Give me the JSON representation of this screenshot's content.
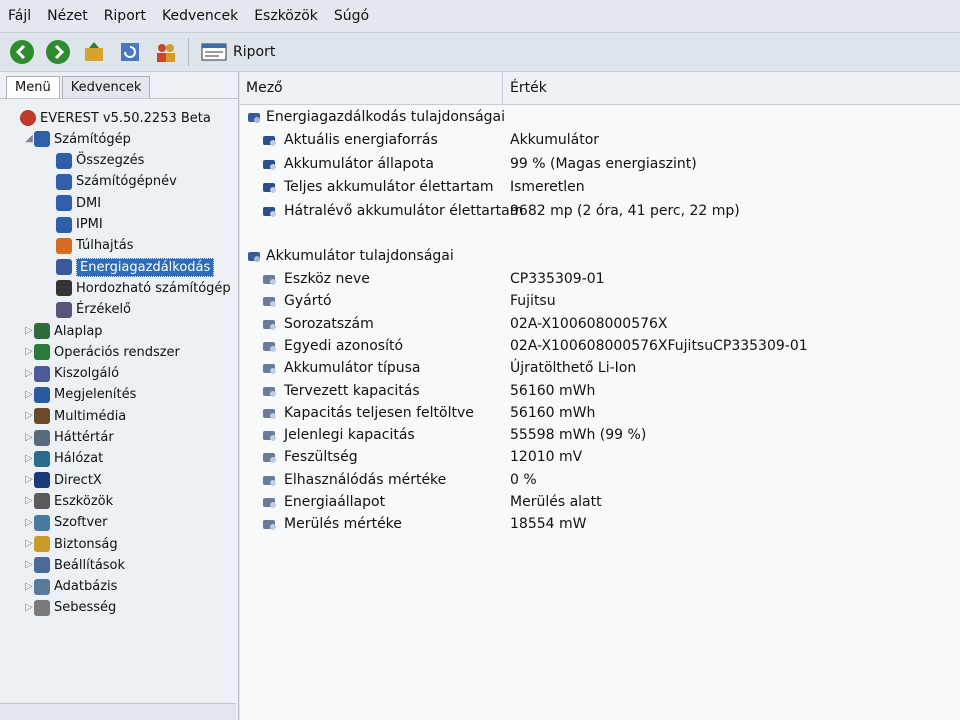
{
  "menubar": {
    "items": [
      "Fájl",
      "Nézet",
      "Riport",
      "Kedvencek",
      "Eszközök",
      "Súgó"
    ]
  },
  "toolbar": {
    "report_label": "Riport"
  },
  "left_panel": {
    "tabs": [
      "Menü",
      "Kedvencek"
    ],
    "tree": [
      {
        "label": "EVEREST v5.50.2253 Beta",
        "icon": "info-icon"
      },
      {
        "label": "Számítógép",
        "icon": "computer-icon"
      },
      {
        "label": "Összegzés",
        "icon": "computer-icon"
      },
      {
        "label": "Számítógépnév",
        "icon": "computer-icon"
      },
      {
        "label": "DMI",
        "icon": "computer-icon"
      },
      {
        "label": "IPMI",
        "icon": "computer-icon"
      },
      {
        "label": "Túlhajtás",
        "icon": "flame-icon"
      },
      {
        "label": "Energiagazdálkodás",
        "icon": "power-icon",
        "selected": true
      },
      {
        "label": "Hordozható számítógép",
        "icon": "laptop-icon"
      },
      {
        "label": "Érzékelő",
        "icon": "sensor-icon"
      },
      {
        "label": "Alaplap",
        "icon": "motherboard-icon"
      },
      {
        "label": "Operációs rendszer",
        "icon": "windows-icon"
      },
      {
        "label": "Kiszolgáló",
        "icon": "server-icon"
      },
      {
        "label": "Megjelenítés",
        "icon": "display-icon"
      },
      {
        "label": "Multimédia",
        "icon": "multimedia-icon"
      },
      {
        "label": "Háttértár",
        "icon": "storage-icon"
      },
      {
        "label": "Hálózat",
        "icon": "network-icon"
      },
      {
        "label": "DirectX",
        "icon": "directx-icon"
      },
      {
        "label": "Eszközök",
        "icon": "devices-icon"
      },
      {
        "label": "Szoftver",
        "icon": "software-icon"
      },
      {
        "label": "Biztonság",
        "icon": "security-icon"
      },
      {
        "label": "Beállítások",
        "icon": "settings-icon"
      },
      {
        "label": "Adatbázis",
        "icon": "database-icon"
      },
      {
        "label": "Sebesség",
        "icon": "benchmark-icon"
      }
    ]
  },
  "right_panel": {
    "headers": {
      "field": "Mező",
      "value": "Érték"
    },
    "sections": [
      {
        "title": "Energiagazdálkodás tulajdonságai",
        "rows": [
          {
            "field": "Aktuális energiaforrás",
            "value": "Akkumulátor"
          },
          {
            "field": "Akkumulátor állapota",
            "value": "99 % (Magas energiaszint)"
          },
          {
            "field": "Teljes akkumulátor élettartam",
            "value": "Ismeretlen"
          },
          {
            "field": "Hátralévő akkumulátor élettartam",
            "value": "9682 mp (2 óra, 41 perc, 22 mp)"
          }
        ]
      },
      {
        "title": "Akkumulátor tulajdonságai",
        "rows": [
          {
            "field": "Eszköz neve",
            "value": "CP335309-01"
          },
          {
            "field": "Gyártó",
            "value": "Fujitsu"
          },
          {
            "field": "Sorozatszám",
            "value": "02A-X100608000576X"
          },
          {
            "field": "Egyedi azonosító",
            "value": "02A-X100608000576XFujitsuCP335309-01"
          },
          {
            "field": "Akkumulátor típusa",
            "value": "Újratölthető Li-Ion"
          },
          {
            "field": "Tervezett kapacitás",
            "value": "56160 mWh"
          },
          {
            "field": "Kapacitás teljesen feltöltve",
            "value": "56160 mWh"
          },
          {
            "field": "Jelenlegi kapacitás",
            "value": "55598 mWh  (99 %)"
          },
          {
            "field": "Feszültség",
            "value": "12010 mV"
          },
          {
            "field": "Elhasználódás mértéke",
            "value": "0 %"
          },
          {
            "field": "Energiaállapot",
            "value": "Merülés alatt"
          },
          {
            "field": "Merülés mértéke",
            "value": "18554 mW"
          }
        ]
      }
    ]
  }
}
